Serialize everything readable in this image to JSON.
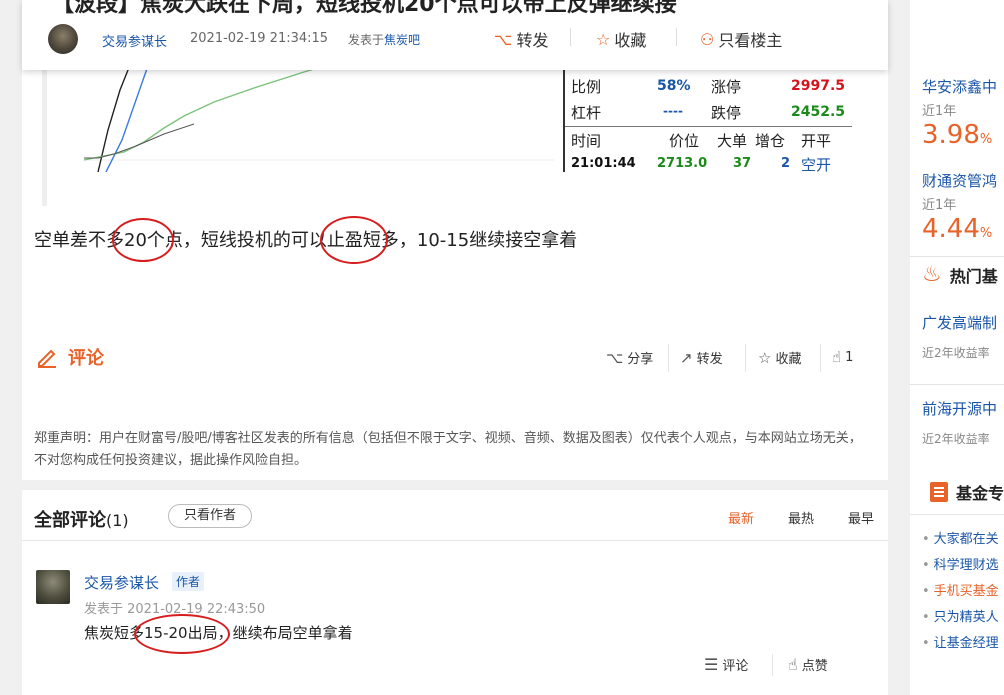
{
  "header": {
    "title": "【波段】焦炭大跌在下周，短线投机20个点可以带上反弹继续接",
    "author": "交易参谋长",
    "time": "2021-02-19 21:34:15",
    "published_prefix": "发表于",
    "bar_name": "焦炭吧",
    "repost_label": "转发",
    "favorite_label": "收藏",
    "only_op_label": "只看楼主"
  },
  "quote_panel": {
    "ratio_label": "比例",
    "ratio_value": "58%",
    "limit_up_label": "涨停",
    "limit_up_value": "2997.5",
    "leverage_label": "杠杆",
    "leverage_value": "----",
    "limit_down_label": "跌停",
    "limit_down_value": "2452.5",
    "col_time": "时间",
    "col_price": "价位",
    "col_big": "大单",
    "col_pos": "增仓",
    "col_type": "开平",
    "row_time": "21:01:44",
    "row_price": "2713.0",
    "row_big": "37",
    "row_pos": "2",
    "row_type": "空开"
  },
  "post": {
    "body": "空单差不多20个点，短线投机的可以止盈短多，10-15继续接空拿着"
  },
  "actions": {
    "comment_label": "评论",
    "share_label": "分享",
    "repost_label": "转发",
    "favorite_label": "收藏",
    "like_count": "1"
  },
  "disclaimer": "郑重声明：用户在财富号/股吧/博客社区发表的所有信息（包括但不限于文字、视频、音频、数据及图表）仅代表个人观点，与本网站立场无关，不对您构成任何投资建议，据此操作风险自担。",
  "comments_section": {
    "title": "全部评论",
    "count": "(1)",
    "only_author_button": "只看作者",
    "sort_latest": "最新",
    "sort_hot": "最热",
    "sort_earliest": "最早",
    "items": [
      {
        "author": "交易参谋长",
        "badge": "作者",
        "time": "发表于 2021-02-19 22:43:50",
        "text": "焦炭短多15-20出局，继续布局空单拿着",
        "comment_label": "评论",
        "like_label": "点赞"
      }
    ]
  },
  "sidebar": {
    "funds": [
      {
        "name": "华安添鑫中",
        "period": "近1年",
        "rate": "3.98",
        "unit": "%"
      },
      {
        "name": "财通资管鸿",
        "period": "近1年",
        "rate": "4.44",
        "unit": "%"
      }
    ],
    "hot_title": "热门基",
    "hot_funds": [
      {
        "name": "广发高端制",
        "sub": "近2年收益率"
      },
      {
        "name": "前海开源中",
        "sub": "近2年收益率"
      }
    ],
    "fund_title": "基金专",
    "links": [
      {
        "text": "大家都在关",
        "highlight": false
      },
      {
        "text": "科学理财选",
        "highlight": false
      },
      {
        "text": "手机买基金",
        "highlight": true
      },
      {
        "text": "只为精英人",
        "highlight": false
      },
      {
        "text": "让基金经理",
        "highlight": false
      }
    ]
  },
  "colors": {
    "accent": "#e8632a",
    "link": "#1a56a8",
    "circle_mark": "#d61e1e"
  }
}
